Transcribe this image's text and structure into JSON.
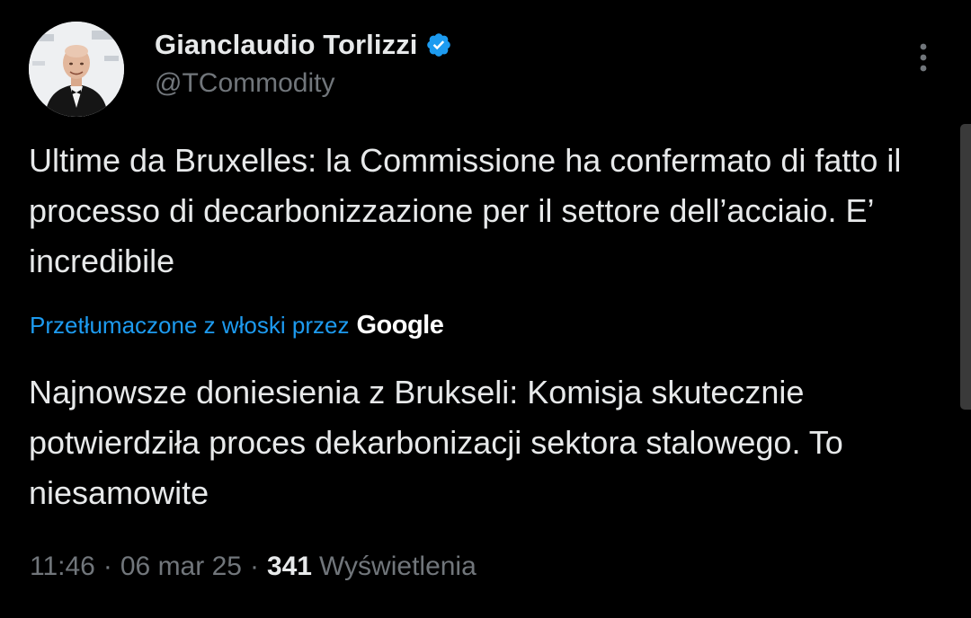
{
  "author": {
    "display_name": "Gianclaudio Torlizzi",
    "handle": "@TCommodity",
    "verified": true,
    "avatar_icon": "profile-photo-man-in-tuxedo"
  },
  "actions": {
    "more_icon": "more-vertical-icon"
  },
  "tweet": {
    "original_text": "Ultime da Bruxelles: la Commissione ha confermato di fatto il processo di decarbonizzazione per il settore dell’acciaio. E’ incredibile",
    "translation_label": "Przetłumaczone z włoski przez",
    "translation_provider": "Google",
    "translated_text": "Najnowsze doniesienia z Brukseli: Komisja skutecznie potwierdziła proces dekarbonizacji sektora stalowego. To niesamowite"
  },
  "meta": {
    "time": "11:46",
    "separator": "·",
    "date": "06 mar 25",
    "views_count": "341",
    "views_label": "Wyświetlenia"
  },
  "colors": {
    "background": "#000000",
    "primary_text": "#e7e9ea",
    "secondary_text": "#71767b",
    "link": "#1d9bf0",
    "verified_badge": "#1d9bf0"
  }
}
